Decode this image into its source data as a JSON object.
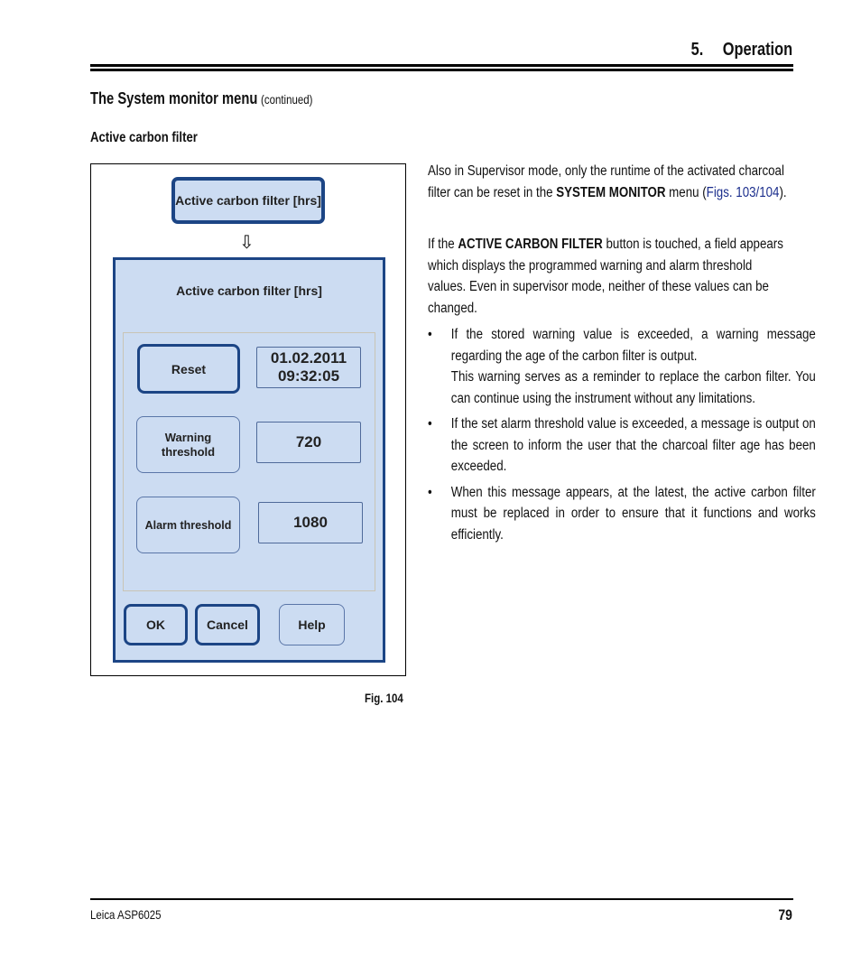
{
  "header": {
    "chapter_number": "5.",
    "chapter_title": "Operation"
  },
  "section": {
    "title": "The System monitor menu",
    "continued": "(continued)"
  },
  "subsection": {
    "title": "Active carbon filter"
  },
  "figure": {
    "top_button_label": "Active carbon filter [hrs]",
    "arrow_icon": "⇩",
    "dialog": {
      "title": "Active carbon filter [hrs]",
      "reset_label": "Reset",
      "reset_date": "01.02.2011",
      "reset_time": "09:32:05",
      "warning_label_line1": "Warning",
      "warning_label_line2": "threshold",
      "warning_value": "720",
      "alarm_label": "Alarm threshold",
      "alarm_value": "1080",
      "ok_label": "OK",
      "cancel_label": "Cancel",
      "help_label": "Help"
    },
    "caption": "Fig. 104"
  },
  "body": {
    "para1_pre": "Also in Supervisor mode, only the runtime of the activated charcoal filter can be reset in the ",
    "para1_bold": "SYSTEM MONITOR",
    "para1_mid": " menu (",
    "para1_link": "Figs. 103/104",
    "para1_post": ").",
    "para2_pre": "If the ",
    "para2_bold": "ACTIVE CARBON FILTER",
    "para2_post": " button is touched, a field appears which displays the programmed warning and alarm threshold values. Even in supervisor mode, neither of these values can be changed.",
    "bullet_char": "•",
    "bullets": [
      {
        "text": "If the stored warning value is exceeded, a warning message regarding the age of the carbon filter is output.",
        "extra": "This warning serves as a reminder to replace the carbon filter. You can continue using the instrument without any limitations."
      },
      {
        "text": "If the set alarm threshold value is exceeded, a message is output on the screen to inform the user that the charcoal filter age has been exceeded."
      },
      {
        "text": "When this message appears, at the latest, the active carbon filter must be replaced in order to ensure that it functions and works efficiently."
      }
    ]
  },
  "footer": {
    "product": "Leica ASP6025",
    "page_number": "79"
  }
}
